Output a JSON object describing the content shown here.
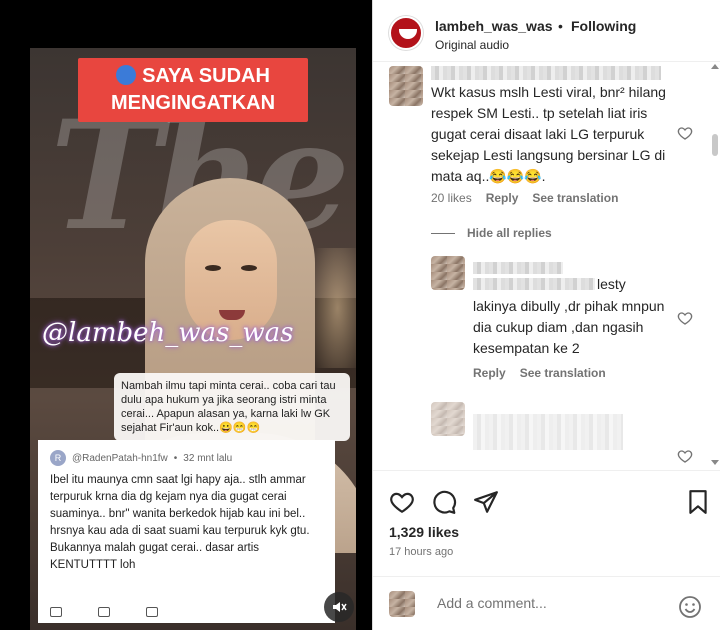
{
  "video": {
    "title_line1": "SAYA SUDAH",
    "title_line2": "MENGINGATKAN",
    "bg_text": "The",
    "watermark": "@lambeh_was_was",
    "quote": "Nambah ilmu tapi minta cerai.. coba cari tau dulu apa hukum ya jika seorang istri minta cerai... Apapun alasan ya, karna laki lw GK sejahat Fir'aun kok..😀😁😁",
    "yt_comment": {
      "avatar_letter": "R",
      "author": "@RadenPatah-hn1fw",
      "sep": "•",
      "time": "32 mnt lalu",
      "text": "Ibel itu maunya cmn saat lgi hapy aja.. stlh ammar terpuruk krna dia dg kejam nya dia gugat cerai suaminya.. bnr\" wanita berkedok hijab kau ini bel.. hrsnya kau ada di saat suami kau terpuruk kyk gtu. Bukannya malah gugat cerai.. dasar artis KENTUTTTT loh"
    }
  },
  "header": {
    "username": "lambeh_was_was",
    "separator": "•",
    "following": "Following",
    "audio": "Original audio"
  },
  "comments": [
    {
      "text": "Wkt kasus mslh Lesti viral, bnr² hilang respek SM Lesti.. tp setelah liat iris gugat cerai disaat laki LG terpuruk sekejap Lesti langsung bersinar LG di mata aq..😂😂😂.",
      "likes": "20 likes",
      "reply": "Reply",
      "translate": "See translation"
    }
  ],
  "hide_replies": "Hide all replies",
  "reply": {
    "partial_top": "lesty",
    "text": "lakinya dibully ,dr pihak mnpun dia cukup diam ,dan ngasih kesempatan ke 2",
    "reply": "Reply",
    "translate": "See translation"
  },
  "post": {
    "likes": "1,329 likes",
    "time": "17 hours ago"
  },
  "add_comment": {
    "placeholder": "Add a comment..."
  },
  "icons": [
    "heart-icon",
    "comment-icon",
    "share-icon",
    "bookmark-icon",
    "emoji-icon",
    "mute-icon",
    "speaking-head-icon"
  ]
}
